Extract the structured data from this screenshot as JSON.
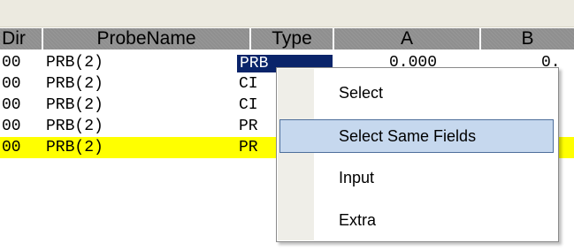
{
  "columns": [
    "Dir",
    "ProbeName",
    "Type",
    "A",
    "B"
  ],
  "rows": [
    {
      "dir": "00",
      "name": "PRB(2)",
      "type": "PRB",
      "a": "0.000",
      "b": "0."
    },
    {
      "dir": "00",
      "name": "PRB(2)",
      "type": "CI",
      "a": "",
      "b": "."
    },
    {
      "dir": "00",
      "name": "PRB(2)",
      "type": "CI",
      "a": "",
      "b": "."
    },
    {
      "dir": "00",
      "name": "PRB(2)",
      "type": "PR",
      "a": "",
      "b": "."
    },
    {
      "dir": "00",
      "name": "PRB(2)",
      "type": "PR",
      "a": "",
      "b": "."
    }
  ],
  "context_menu": {
    "items": [
      {
        "label": "Select"
      },
      {
        "label": "Select Same Fields"
      },
      {
        "label": "Input"
      },
      {
        "label": "Extra"
      }
    ]
  },
  "colors": {
    "highlight_row": "#ffff00",
    "selection": "#0a246a",
    "menu_hover": "#c6d8ee",
    "header": "#8f8f8f"
  }
}
